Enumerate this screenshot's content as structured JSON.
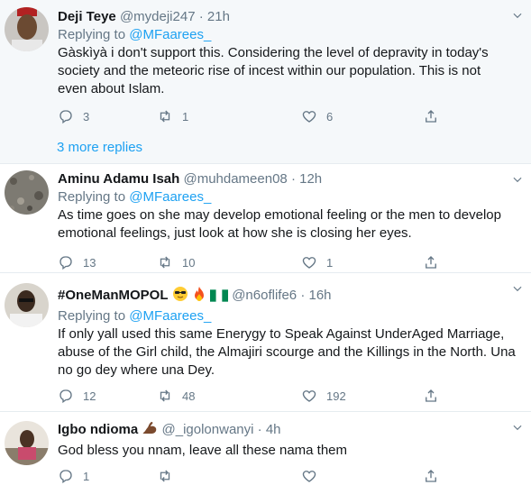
{
  "tweets": [
    {
      "name": "Deji Teye",
      "handle": "@mydeji247",
      "time": "21h",
      "reply_prefix": "Replying to",
      "reply_to": "@MFaarees_",
      "text": "Gàskìyà i don't support this. Considering the level of depravity in today's society and the meteoric rise of incest within our population. This is not even about Islam.",
      "replies": "3",
      "retweets": "1",
      "likes": "6"
    },
    {
      "name": "Aminu Adamu Isah",
      "handle": "@muhdameen08",
      "time": "12h",
      "reply_prefix": "Replying to",
      "reply_to": "@MFaarees_",
      "text": "As time goes on she may develop emotional feeling or the men to develop emotional feelings, just look at how she is closing her eyes.",
      "replies": "13",
      "retweets": "10",
      "likes": "1"
    },
    {
      "name": "#OneManMOPOL",
      "handle": "@n6oflife6",
      "time": "16h",
      "reply_prefix": "Replying to",
      "reply_to": "@MFaarees_",
      "text": "If only yall used this same Enerygy to Speak Against UnderAged Marriage, abuse of the Girl child, the Almajiri scourge and the Killings in the North. Una no go dey where una Dey.",
      "replies": "12",
      "retweets": "48",
      "likes": "192"
    },
    {
      "name": "Igbo ndioma",
      "handle": "@_igolonwanyi",
      "time": "4h",
      "text": "God bless you nnam, leave all these nama them",
      "replies": "1",
      "retweets": "",
      "likes": ""
    }
  ],
  "more_replies": "3 more replies",
  "separator": "·",
  "colors": {
    "accent": "#1da1f2",
    "muted": "#657786",
    "text": "#14171a",
    "thread_bg": "#f5f8fa"
  },
  "icons": [
    "reply-icon",
    "retweet-icon",
    "like-icon",
    "share-icon",
    "caret-down-icon",
    "sunglasses-emoji",
    "fire-emoji",
    "nigeria-flag-emoji",
    "flexed-biceps-emoji"
  ]
}
